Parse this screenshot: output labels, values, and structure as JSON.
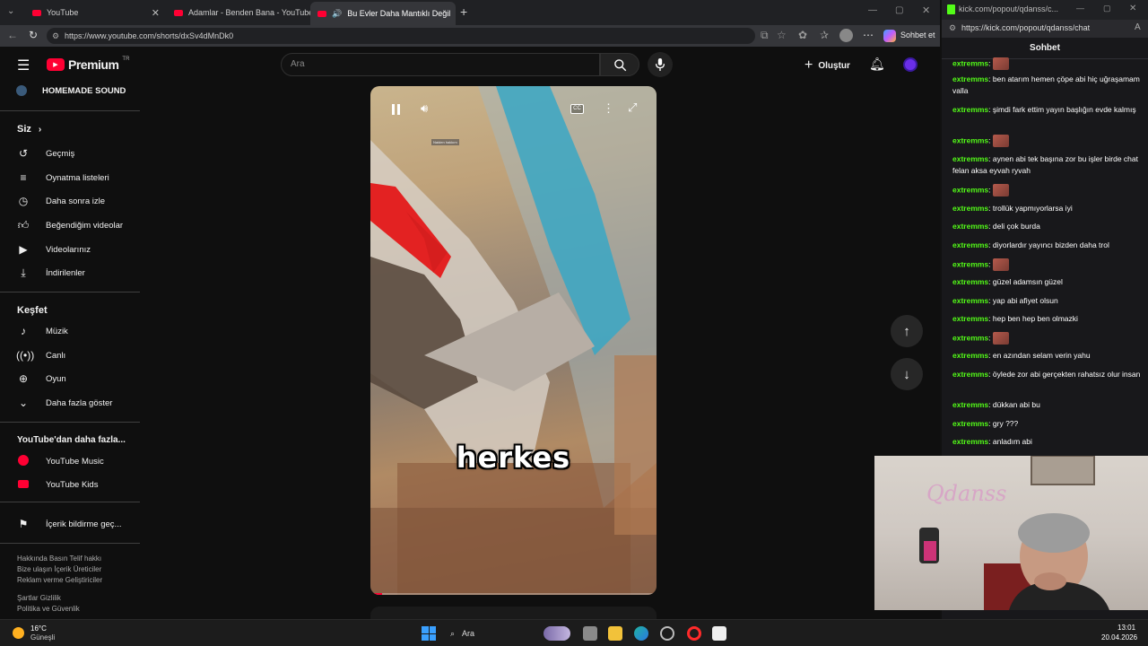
{
  "browser": {
    "tabs": [
      {
        "label": "YouTube"
      },
      {
        "label": "Adamlar - Benden Bana - YouTube"
      },
      {
        "label": "Bu Evler Daha Mantıklı Değil"
      }
    ],
    "url": "https://www.youtube.com/shorts/dxSv4dMnDk0"
  },
  "youtube": {
    "logo": "Premium",
    "logo_sup": "TR",
    "search_placeholder": "Ara",
    "create_label": "Oluştur",
    "channel": "HOMEMADE SOUND",
    "you_label": "Siz",
    "you_items": [
      "Geçmiş",
      "Oynatma listeleri",
      "Daha sonra izle",
      "Beğendiğim videolar",
      "Videolarınız",
      "İndirilenler"
    ],
    "explore_label": "Keşfet",
    "explore_items": [
      "Müzik",
      "Canlı",
      "Oyun",
      "Daha fazla göster"
    ],
    "more_label": "YouTube'dan daha fazla...",
    "more_items": [
      "YouTube Music",
      "YouTube Kids"
    ],
    "report_label": "İçerik bildirme geç...",
    "footer1": "Hakkında  Basın  Telif hakkı",
    "footer2": "Bize ulaşın  İçerik Üreticiler",
    "footer3": "Reklam verme  Geliştiriciler",
    "footer4": "Şartlar  Gizlilik",
    "footer5": "Politika ve Güvenlik",
    "caption": "herkes",
    "small_sign": "Naiden hakkım"
  },
  "kick": {
    "url": "kick.com/popout/qdanss/c...",
    "url_full": "https://kick.com/popout/qdanss/chat",
    "header": "Sohbet",
    "sohbet_btn": "Sohbet et",
    "messages": [
      {
        "user": "extremms",
        "text": "ben atarım hemen çöpe abi hiç uğraşamam valla"
      },
      {
        "user": "extremms",
        "text": "şimdi fark ettim yayın başlığın evde kalmış"
      },
      {
        "user": "extremms",
        "text": ""
      },
      {
        "user": "extremms",
        "text": "aynen abi tek başına zor bu işler birde chat felan aksa eyvah ryvah"
      },
      {
        "user": "extremms",
        "text": ""
      },
      {
        "user": "extremms",
        "text": "trollük yapmıyorlarsa iyi"
      },
      {
        "user": "extremms",
        "text": "deli çok burda"
      },
      {
        "user": "extremms",
        "text": "diyorlardır yayıncı bizden daha trol"
      },
      {
        "user": "extremms",
        "text": ""
      },
      {
        "user": "extremms",
        "text": "güzel adamsın güzel"
      },
      {
        "user": "extremms",
        "text": "yap abi afiyet olsun"
      },
      {
        "user": "extremms",
        "text": "hep ben hep ben olmazki"
      },
      {
        "user": "extremms",
        "text": ""
      },
      {
        "user": "extremms",
        "text": "en azından selam verin yahu"
      },
      {
        "user": "extremms",
        "text": "öylede zor abi gerçekten rahatsız olur insan"
      },
      {
        "user": "extremms",
        "text": "dükkan abi bu"
      },
      {
        "user": "extremms",
        "text": "gry ???"
      },
      {
        "user": "extremms",
        "text": "anladım abi"
      }
    ],
    "webcam_logo": "Qdanss"
  },
  "taskbar": {
    "weather_temp": "16°C",
    "weather_label": "Güneşli",
    "search_label": "Ara",
    "time": "13:01",
    "date": "20.04.2026"
  }
}
